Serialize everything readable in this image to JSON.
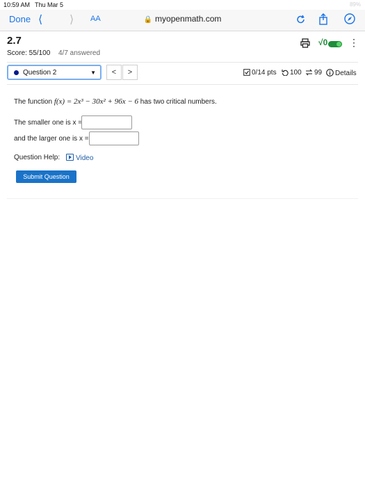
{
  "status": {
    "time": "10:59 AM",
    "date": "Thu Mar 5",
    "battery": "89%"
  },
  "browser": {
    "done_label": "Done",
    "text_size_label": "AA",
    "url": "myopenmath.com"
  },
  "assessment": {
    "title": "2.7",
    "score": "Score: 55/100",
    "answered": "4/7 answered"
  },
  "question_nav": {
    "selected": "Question 2",
    "prev_label": "<",
    "next_label": ">",
    "points": "0/14 pts",
    "retries": "100",
    "regens": "99",
    "details_label": "Details"
  },
  "question": {
    "prefix": "The function ",
    "math_html": "f(x) = 2x³ − 30x² + 96x − 6",
    "suffix": " has two critical numbers.",
    "smaller_label": "The smaller one is x =",
    "larger_label": "and the larger one is x =",
    "smaller_value": "",
    "larger_value": ""
  },
  "help": {
    "label": "Question Help:",
    "video_label": "Video"
  },
  "actions": {
    "submit_label": "Submit Question"
  },
  "colors": {
    "accent": "#1a73e8",
    "toggle": "#1e8c3a",
    "submit": "#1a73c8",
    "dot": "#001a8c"
  }
}
